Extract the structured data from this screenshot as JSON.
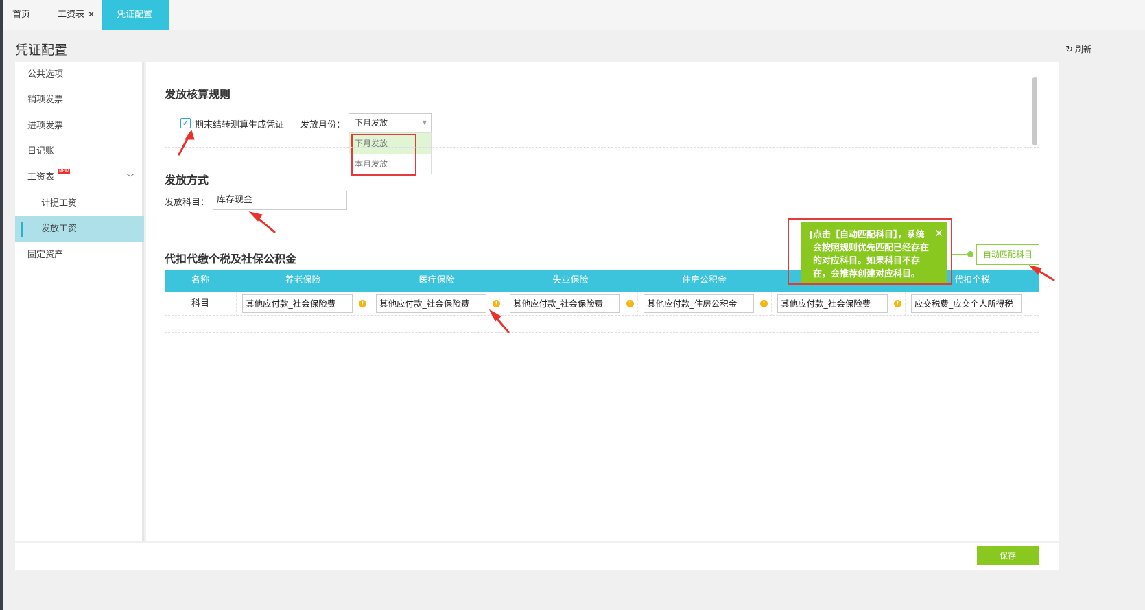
{
  "tabs": [
    {
      "label": "首页",
      "closable": false,
      "active": false
    },
    {
      "label": "工资表",
      "closable": true,
      "active": false
    },
    {
      "label": "凭证配置",
      "closable": true,
      "active": true
    }
  ],
  "header": {
    "title": "凭证配置",
    "refresh_label": "刷新",
    "refresh_icon": "refresh-icon"
  },
  "sidebar": {
    "items": [
      {
        "label": "公共选项"
      },
      {
        "label": "销项发票"
      },
      {
        "label": "进项发票"
      },
      {
        "label": "日记账"
      },
      {
        "label": "工资表",
        "badge": "NEW",
        "expanded": true
      },
      {
        "label": "计提工资"
      },
      {
        "label": "发放工资",
        "active": true
      },
      {
        "label": "固定资产"
      }
    ]
  },
  "rules": {
    "title": "发放核算规则",
    "checkbox_label": "期末结转测算生成凭证",
    "checked": true,
    "month_label": "发放月份：",
    "month_value": "下月发放",
    "month_options": [
      "下月发放",
      "本月发放"
    ]
  },
  "method": {
    "title": "发放方式",
    "account_label": "发放科目：",
    "account_value": "库存现金"
  },
  "withholding": {
    "title": "代扣代缴个税及社保公积金",
    "columns": [
      "名称",
      "养老保险",
      "医疗保险",
      "失业保险",
      "住房公积金",
      "",
      "代扣个税"
    ],
    "row_label": "科目",
    "cells": [
      "其他应付款_社会保险费",
      "其他应付款_社会保险费",
      "其他应付款_社会保险费",
      "其他应付款_住房公积金",
      "其他应付款_社会保险费",
      "应交税费_应交个人所得税"
    ],
    "auto_match_label": "自动匹配科目"
  },
  "tooltip": {
    "line1": "点击【自动匹配科目】，系统",
    "line2": "会按照规则优先匹配已经存在",
    "line3": "的对应科目。如果科目不存",
    "line4": "在，会推荐创建对应科目。"
  },
  "footer": {
    "save_label": "保存"
  },
  "colors": {
    "accent": "#33c3dc",
    "green": "#88c81f",
    "warning": "#f5b50f",
    "highlight": "#e23b3b"
  }
}
